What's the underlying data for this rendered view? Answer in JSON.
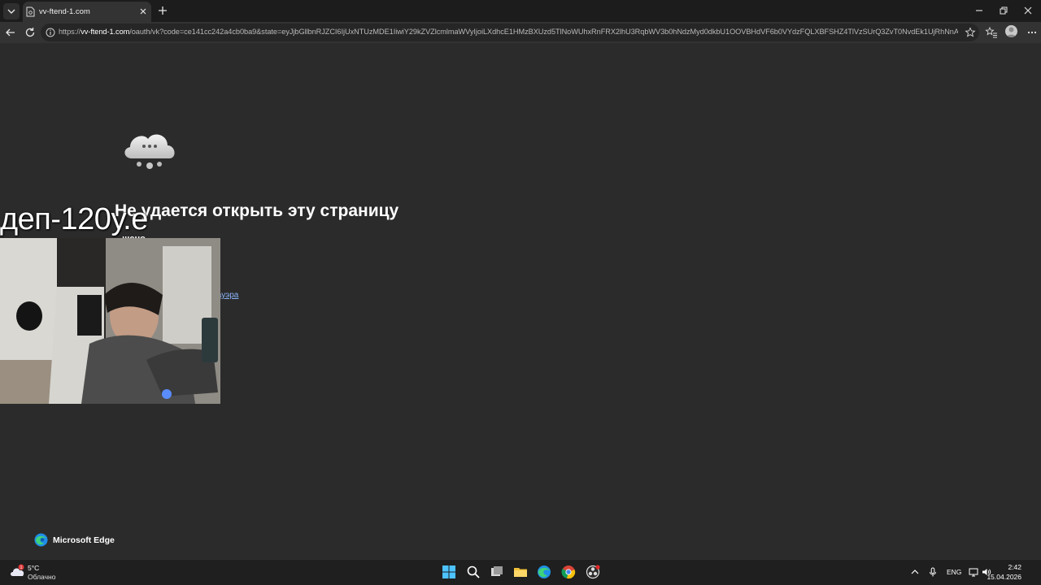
{
  "browser": {
    "tab_title": "vv-ftend-1.com",
    "url_prefix": "https://",
    "url_host": "vv-ftend-1.com",
    "url_path": "/oauth/vk?code=ce141cc242a4cb0ba9&state=eyJjbGllbnRJZCI6IjUxNTUzMDE1IiwiY29kZVZlcmlmaWVyIjoiLXdhcE1HMzBXUzd5TlNoWUhxRnFRX2lhU3RqbWV3b0hNdzMyd0dkbU1OOVBHdVF6b0VYdzFQLXBFSHZ4TlVzSUrQ3ZvT0NvdEk1UjRhNnA..."
  },
  "error_page": {
    "title": "Не удается открыть эту страницу",
    "subtitle_visible": "...шено.",
    "link_visible": "а и брандмауэра"
  },
  "overlay": {
    "stream_text": "деп-120у.е"
  },
  "footer": {
    "brand_name": "Microsoft Edge"
  },
  "taskbar": {
    "weather_temp": "5°C",
    "weather_desc": "Облачно",
    "weather_badge": "1",
    "language": "ENG",
    "time": "2:42",
    "date": "15.04.2026"
  },
  "colors": {
    "page_bg": "#2b2b2b",
    "link": "#8ab4f8",
    "edge_blue": "#1f8ee8",
    "edge_green": "#3fd27a"
  }
}
